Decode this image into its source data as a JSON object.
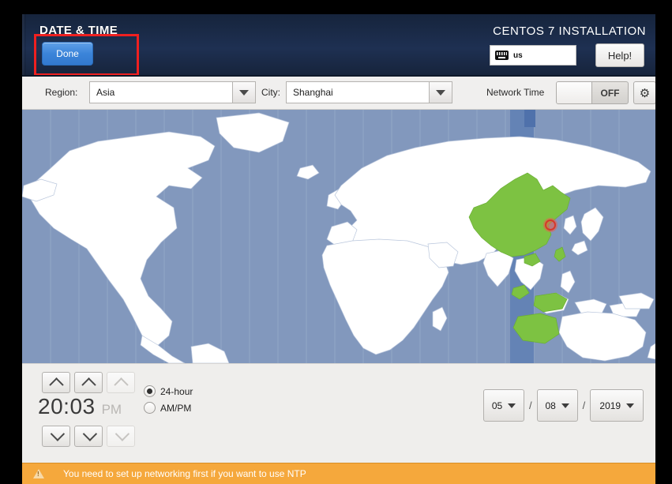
{
  "header": {
    "title": "DATE & TIME",
    "done_label": "Done",
    "product_label": "CENTOS 7 INSTALLATION",
    "keyboard_layout": "us",
    "keyboard_icon": "keyboard-icon",
    "help_label": "Help!"
  },
  "selector_bar": {
    "region_label": "Region:",
    "region_value": "Asia",
    "city_label": "City:",
    "city_value": "Shanghai",
    "network_time_label": "Network Time",
    "network_time_state": "OFF",
    "settings_icon": "gear-icon"
  },
  "map": {
    "ocean_color": "#8298bd",
    "land_color": "#ffffff",
    "selected_region_color": "#7dc242",
    "timezone_band_color": "#5f7fb4",
    "marker_color": "#e8604c",
    "selected_city": "Shanghai"
  },
  "time": {
    "hours": "20",
    "separator": ":",
    "minutes": "03",
    "ampm_label": "PM",
    "format_options": [
      {
        "label": "24-hour",
        "selected": true
      },
      {
        "label": "AM/PM",
        "selected": false
      }
    ],
    "up_icon": "chevron-up-icon",
    "down_icon": "chevron-down-icon"
  },
  "date": {
    "month": "05",
    "day": "08",
    "year": "2019",
    "separator": "/"
  },
  "warning": {
    "icon": "warning-triangle-icon",
    "message": "You need to set up networking first if you want to use NTP"
  },
  "annotation": {
    "highlight_color": "#ef2020",
    "target": "done-button"
  }
}
